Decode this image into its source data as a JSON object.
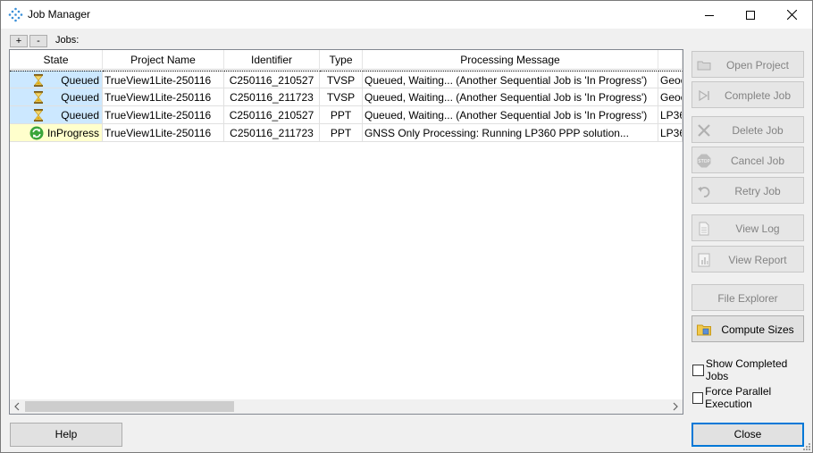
{
  "window": {
    "title": "Job Manager"
  },
  "toolbar": {
    "add_label": "+",
    "remove_label": "-",
    "jobs_label": "Jobs:"
  },
  "table": {
    "columns": [
      "State",
      "Project Name",
      "Identifier",
      "Type",
      "Processing Message"
    ],
    "rows": [
      {
        "state": "Queued",
        "icon": "hourglass-icon",
        "project": "TrueView1Lite-250116",
        "identifier": "C250116_210527",
        "type": "TVSP",
        "message": "Queued, Waiting... (Another Sequential Job is 'In Progress')",
        "extra": "Geoc"
      },
      {
        "state": "Queued",
        "icon": "hourglass-icon",
        "project": "TrueView1Lite-250116",
        "identifier": "C250116_211723",
        "type": "TVSP",
        "message": "Queued, Waiting... (Another Sequential Job is 'In Progress')",
        "extra": "Geoc"
      },
      {
        "state": "Queued",
        "icon": "hourglass-icon",
        "project": "TrueView1Lite-250116",
        "identifier": "C250116_210527",
        "type": "PPT",
        "message": "Queued, Waiting... (Another Sequential Job is 'In Progress')",
        "extra": "LP36"
      },
      {
        "state": "InProgress",
        "icon": "refresh-icon",
        "project": "TrueView1Lite-250116",
        "identifier": "C250116_211723",
        "type": "PPT",
        "message": "GNSS Only Processing: Running LP360 PPP solution...",
        "extra": "LP36"
      }
    ]
  },
  "actions": {
    "open_project": "Open Project",
    "complete_job": "Complete Job",
    "delete_job": "Delete Job",
    "cancel_job": "Cancel Job",
    "retry_job": "Retry Job",
    "view_log": "View Log",
    "view_report": "View Report",
    "file_explorer": "File Explorer",
    "compute_sizes": "Compute Sizes"
  },
  "options": {
    "show_completed_jobs": "Show Completed Jobs",
    "force_parallel_execution": "Force Parallel Execution"
  },
  "footer": {
    "help_label": "Help",
    "close_label": "Close"
  },
  "colors": {
    "queued_bg": "#cce8ff",
    "inprogress_bg": "#ffffcc",
    "focus_border": "#0078d7"
  }
}
